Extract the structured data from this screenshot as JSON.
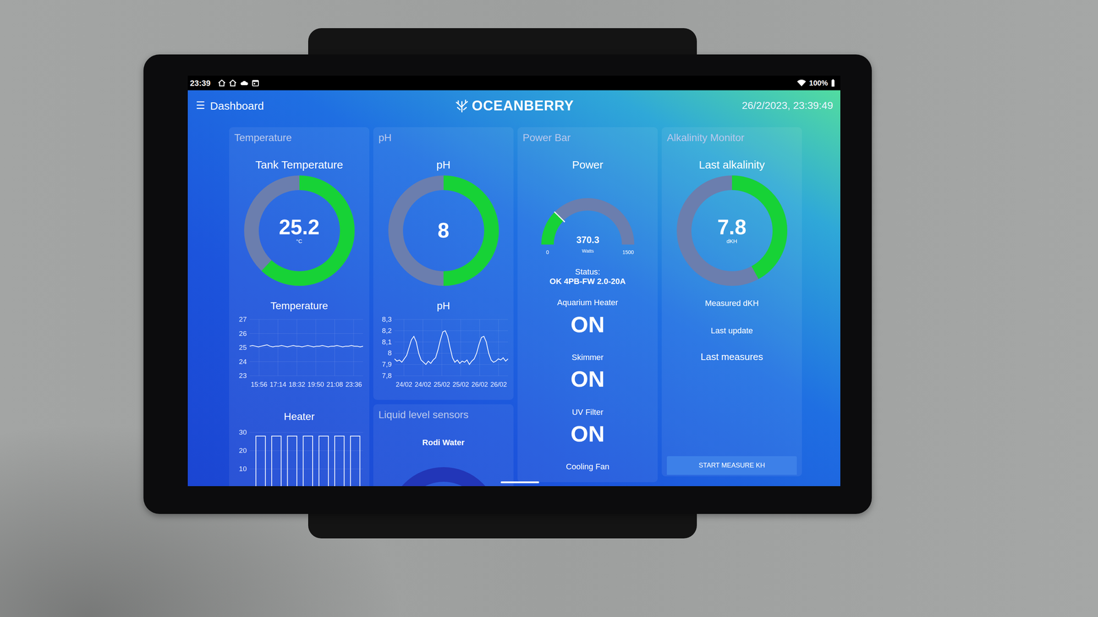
{
  "status_bar": {
    "time": "23:39",
    "battery": "100%"
  },
  "header": {
    "menu_icon": "☰",
    "title": "Dashboard",
    "brand": "OCEANBERRY",
    "datetime": "26/2/2023, 23:39:49"
  },
  "temperature": {
    "title": "Temperature",
    "gauge": {
      "title": "Tank Temperature",
      "value": "25.2",
      "unit": "°C",
      "level": 0.62
    },
    "chart": {
      "title": "Temperature",
      "y_ticks": [
        "27",
        "26",
        "25",
        "24",
        "23"
      ],
      "x_ticks": [
        "15:56",
        "17:14",
        "18:32",
        "19:50",
        "21:08",
        "23:36"
      ],
      "values": [
        25.1,
        25.15,
        25.1,
        25.05,
        25.1,
        25.15,
        25.2,
        25.1,
        25.05,
        25.1,
        25.1,
        25.15,
        25.1,
        25.05,
        25.1,
        25.15,
        25.1,
        25.1,
        25.05,
        25.1,
        25.15,
        25.1,
        25.05,
        25.1,
        25.1,
        25.15,
        25.1,
        25.05,
        25.1,
        25.1,
        25.15,
        25.1,
        25.05,
        25.1,
        25.1,
        25.15,
        25.1,
        25.1,
        25.05,
        25.1
      ]
    },
    "heater": {
      "title": "Heater",
      "y_ticks": [
        "30",
        "20",
        "10"
      ],
      "values": [
        0,
        0,
        28,
        28,
        28,
        0,
        0,
        28,
        28,
        28,
        0,
        0,
        28,
        28,
        28,
        0,
        0,
        28,
        28,
        28,
        0,
        0,
        28,
        28,
        28,
        0,
        0,
        28,
        28,
        28,
        0,
        0,
        28,
        28,
        28,
        0
      ]
    }
  },
  "ph": {
    "title": "pH",
    "gauge": {
      "title": "pH",
      "value": "8",
      "level": 0.5
    },
    "chart": {
      "title": "pH",
      "y_ticks": [
        "8,3",
        "8,2",
        "8,1",
        "8",
        "7,9",
        "7,8"
      ],
      "x_ticks": [
        "24/02",
        "24/02",
        "25/02",
        "25/02",
        "26/02",
        "26/02"
      ],
      "values": [
        7.95,
        7.93,
        7.94,
        7.92,
        7.95,
        7.98,
        8.05,
        8.12,
        8.15,
        8.1,
        8.0,
        7.94,
        7.92,
        7.9,
        7.93,
        7.91,
        7.94,
        7.96,
        8.03,
        8.12,
        8.19,
        8.2,
        8.15,
        8.05,
        7.96,
        7.92,
        7.94,
        7.91,
        7.93,
        7.92,
        7.94,
        7.9,
        7.93,
        7.95,
        8.0,
        8.08,
        8.14,
        8.15,
        8.1,
        8.0,
        7.94,
        7.92,
        7.93,
        7.95,
        7.94,
        7.96,
        7.93,
        7.95
      ]
    }
  },
  "liquid_level": {
    "title": "Liquid level sensors",
    "sensors": [
      {
        "name": "Rodi Water"
      }
    ]
  },
  "power": {
    "title": "Power Bar",
    "gauge": {
      "title": "Power",
      "value": "370.3",
      "unit": "Watts",
      "min": "0",
      "max": "1500",
      "level": 0.247
    },
    "status_label": "Status:",
    "status": "OK 4PB-FW 2.0-20A",
    "outlets": [
      {
        "name": "Aquarium Heater",
        "state": "ON"
      },
      {
        "name": "Skimmer",
        "state": "ON"
      },
      {
        "name": "UV Filter",
        "state": "ON"
      },
      {
        "name": "Cooling Fan"
      }
    ]
  },
  "alkalinity": {
    "title": "Alkalinity Monitor",
    "gauge": {
      "title": "Last alkalinity",
      "value": "7.8",
      "unit": "dKH",
      "level": 0.42
    },
    "measured_label": "Measured dKH",
    "last_update_label": "Last update",
    "last_measures_label": "Last measures",
    "button": "START MEASURE KH"
  }
}
